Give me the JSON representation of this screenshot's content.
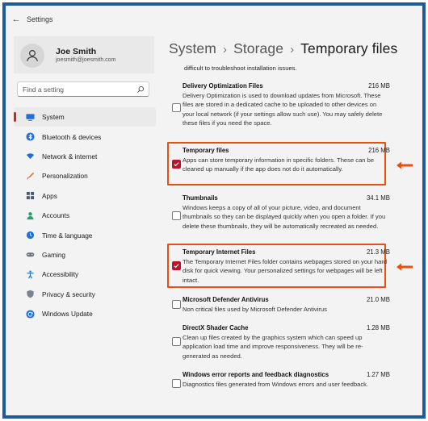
{
  "window": {
    "app_title": "Settings"
  },
  "profile": {
    "name": "Joe Smith",
    "email": "joesmith@joesmith.com"
  },
  "search": {
    "placeholder": "Find a setting"
  },
  "nav": [
    {
      "label": "System",
      "icon": "monitor-icon",
      "active": true
    },
    {
      "label": "Bluetooth & devices",
      "icon": "bluetooth-icon"
    },
    {
      "label": "Network & internet",
      "icon": "wifi-icon"
    },
    {
      "label": "Personalization",
      "icon": "brush-icon"
    },
    {
      "label": "Apps",
      "icon": "apps-icon"
    },
    {
      "label": "Accounts",
      "icon": "person-icon"
    },
    {
      "label": "Time & language",
      "icon": "globe-clock-icon"
    },
    {
      "label": "Gaming",
      "icon": "gamepad-icon"
    },
    {
      "label": "Accessibility",
      "icon": "accessibility-icon"
    },
    {
      "label": "Privacy & security",
      "icon": "shield-icon"
    },
    {
      "label": "Windows Update",
      "icon": "update-icon"
    }
  ],
  "breadcrumb": {
    "level1": "System",
    "level2": "Storage",
    "current": "Temporary files",
    "separator": "›"
  },
  "intro_text": "difficult to troubleshoot installation issues.",
  "items": [
    {
      "title": "Delivery Optimization Files",
      "size": "216 MB",
      "checked": false,
      "highlighted": false,
      "description": "Delivery Optimization is used to download updates from Microsoft. These files are stored in a dedicated cache to be uploaded to other devices on your local network (if your settings allow such use). You may safely delete these files if you need the space."
    },
    {
      "title": "Temporary files",
      "size": "216 MB",
      "checked": true,
      "highlighted": true,
      "description": "Apps can store temporary information in specific folders. These can be cleaned up manually if the app does not do it automatically."
    },
    {
      "title": "Thumbnails",
      "size": "34.1 MB",
      "checked": false,
      "highlighted": false,
      "description": "Windows keeps a copy of all of your picture, video, and document thumbnails so they can be displayed quickly when you open a folder. If you delete these thumbnails, they will be automatically recreated as needed."
    },
    {
      "title": "Temporary Internet Files",
      "size": "21.3 MB",
      "checked": true,
      "highlighted": true,
      "description": "The Temporary Internet Files folder contains webpages stored on your hard disk for quick viewing. Your personalized settings for webpages will be left intact."
    },
    {
      "title": "Microsoft Defender Antivirus",
      "size": "21.0 MB",
      "checked": false,
      "highlighted": false,
      "description": "Non critical files used by Microsoft Defender Antivirus"
    },
    {
      "title": "DirectX Shader Cache",
      "size": "1.28 MB",
      "checked": false,
      "highlighted": false,
      "description": "Clean up files created by the graphics system which can speed up application load time and improve responsiveness. They will be re-generated as needed."
    },
    {
      "title": "Windows error reports and feedback diagnostics",
      "size": "1.27 MB",
      "checked": false,
      "highlighted": false,
      "description": "Diagnostics files generated from Windows errors and user feedback."
    }
  ],
  "colors": {
    "frame": "#1e5aa0",
    "highlight": "#e8500f",
    "checkbox_checked": "#c0122b",
    "accent": "#c42b1c"
  }
}
